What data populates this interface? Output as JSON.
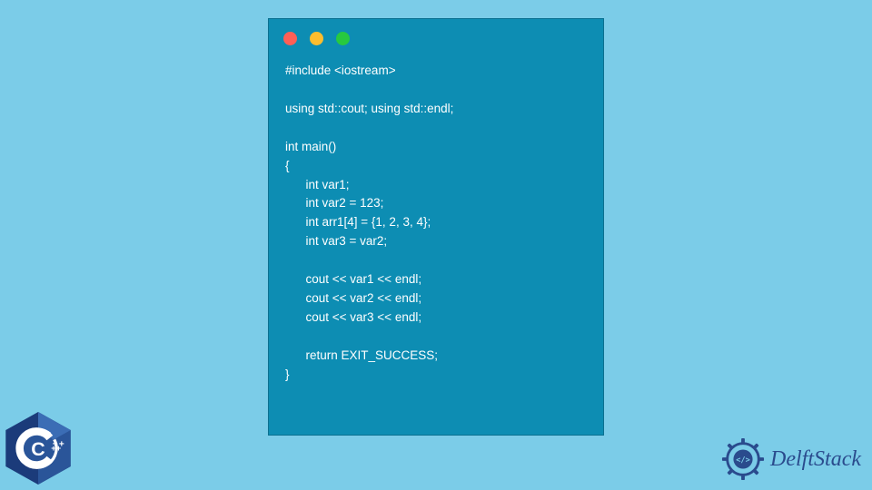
{
  "code": {
    "lines": [
      "#include <iostream>",
      "",
      "using std::cout; using std::endl;",
      "",
      "int main()",
      "{",
      "      int var1;",
      "      int var2 = 123;",
      "      int arr1[4] = {1, 2, 3, 4};",
      "      int var3 = var2;",
      "",
      "      cout << var1 << endl;",
      "      cout << var2 << endl;",
      "      cout << var3 << endl;",
      "",
      "      return EXIT_SUCCESS;",
      "}"
    ]
  },
  "branding": {
    "name": "DelftStack"
  },
  "language_badge": {
    "text": "C++"
  },
  "window": {
    "dot_colors": [
      "#ff5f56",
      "#ffbd2e",
      "#27c93f"
    ]
  }
}
